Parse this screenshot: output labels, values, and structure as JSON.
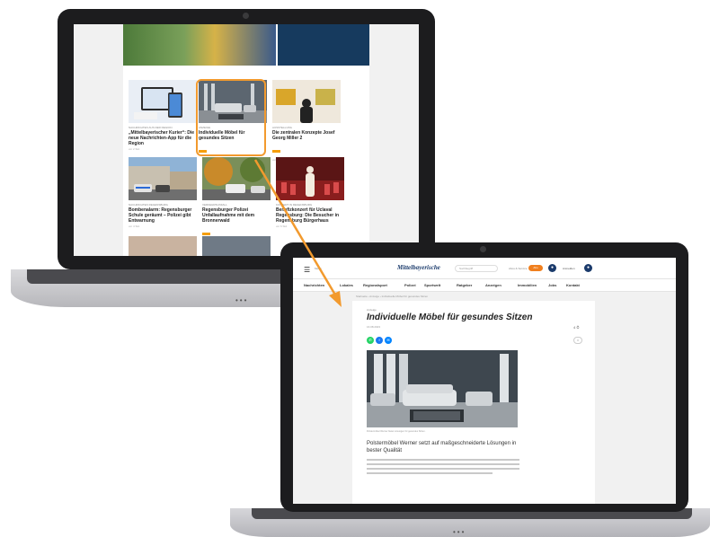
{
  "laptop_back": {
    "highlighted_card": 1,
    "cards": [
      {
        "kicker": "Nachrichten aus der Region",
        "title": "„Mittelbayerischer Kurier“: Die neue Nachrichten-App für die Region",
        "date": "vor 2 Std.",
        "plus": false
      },
      {
        "kicker": "Anzeige",
        "title": "Individuelle Möbel für gesundes Sitzen",
        "date": "",
        "plus": true
      },
      {
        "kicker": "Ausstellung",
        "title": "Die zentralen Konzepte Josef Georg Miller 2",
        "date": "vor 3 Std.",
        "plus": true
      },
      {
        "kicker": "Nachrichten Regensburg",
        "title": "Bombenalarm: Regensburger Schule geräumt – Polizei gibt Entwarnung",
        "date": "vor 4 Std.",
        "plus": false
      },
      {
        "kicker": "Verkehrsunfall",
        "title": "Regensburger Polizei Unfallaufnahme mit dem Bronnerwald",
        "date": "vor 5 Std.",
        "plus": true
      },
      {
        "kicker": "Konzert in Regensburg",
        "title": "Benefizkonzert für Uclaval Regensburg: Die Besucher in Regensburg Bürgerhaus",
        "date": "vor 6 Std.",
        "plus": false
      }
    ]
  },
  "laptop_front": {
    "header": {
      "menu_label": "Menü",
      "logo": "Mittelbayerische",
      "search_placeholder": "Suchbegriff",
      "extra_label": "Abos & Service",
      "abo_button": "Abo",
      "login_label": "Anmelden"
    },
    "nav": [
      "Nachrichten",
      "Lokales",
      "Regionalsport",
      "Polizei",
      "Sportwelt",
      "Ratgeber",
      "Anzeigen",
      "Immobilien",
      "Jobs",
      "Kontakt"
    ],
    "breadcrumb": "Startseite › Anzeige › Individuelle Möbel für gesundes Sitzen",
    "article": {
      "kicker": "Anzeige",
      "title": "Individuelle Möbel für gesundes Sitzen",
      "date": "16.08.2023",
      "reading_time": "4 ⏱",
      "caption": "Polstermöbel Werner bietet Lösungen für gesundes Sitzen.",
      "lead": "Polstermöbel Werner setzt auf maßgeschneiderte Lösungen in bester Qualität"
    },
    "share_icons": [
      {
        "name": "whatsapp-icon",
        "color": "#25d366",
        "glyph": "✆"
      },
      {
        "name": "facebook-icon",
        "color": "#1877f2",
        "glyph": "f"
      },
      {
        "name": "messenger-icon",
        "color": "#0084ff",
        "glyph": "✉"
      }
    ]
  },
  "colors": {
    "highlight": "#f29a2e",
    "arrow": "#f29a2e",
    "brand_blue": "#1a3a6b",
    "abo_orange": "#f07f1e"
  }
}
